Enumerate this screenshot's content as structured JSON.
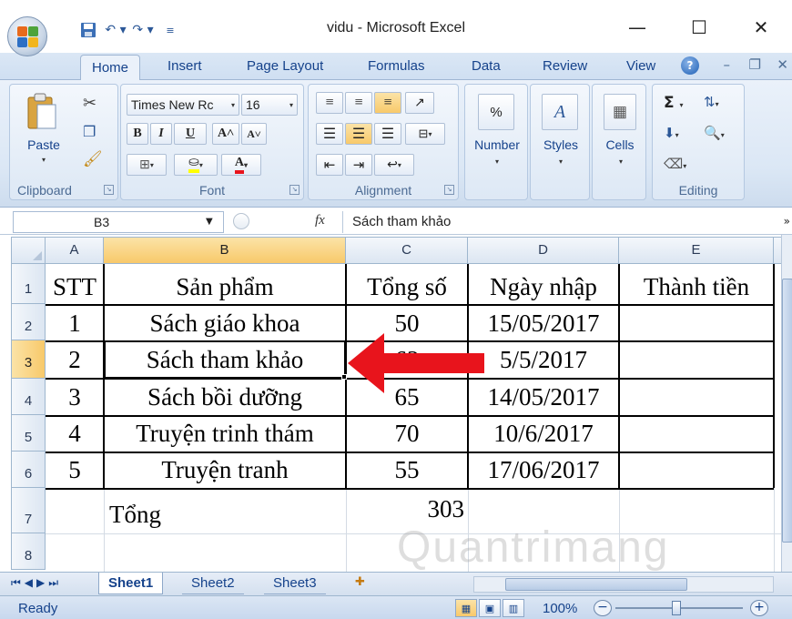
{
  "window": {
    "title": "vidu - Microsoft Excel",
    "minimize": "—",
    "maximize": "☐",
    "close": "✕"
  },
  "qat": {
    "save_icon": "💾",
    "undo": "↶ ▾",
    "redo": "↷ ▾",
    "customize": "≡"
  },
  "tabs": [
    {
      "label": "Home",
      "active": true
    },
    {
      "label": "Insert"
    },
    {
      "label": "Page Layout"
    },
    {
      "label": "Formulas"
    },
    {
      "label": "Data"
    },
    {
      "label": "Review"
    },
    {
      "label": "View"
    }
  ],
  "ribbon": {
    "clipboard": {
      "label": "Clipboard",
      "paste": "Paste"
    },
    "font": {
      "label": "Font",
      "name": "Times New Rc",
      "size": "16",
      "bold": "B",
      "italic": "I",
      "underline": "U",
      "grow": "A˄",
      "shrink": "A˅",
      "color_letter": "A"
    },
    "alignment": {
      "label": "Alignment"
    },
    "number": {
      "label": "Number",
      "percent": "%"
    },
    "styles": {
      "label": "Styles"
    },
    "cells": {
      "label": "Cells"
    },
    "editing": {
      "label": "Editing",
      "sum": "Σ"
    }
  },
  "formula_bar": {
    "name_box": "B3",
    "fx": "fx",
    "content": "Sách tham khảo"
  },
  "columns": [
    "A",
    "B",
    "C",
    "D",
    "E"
  ],
  "rows": [
    "1",
    "2",
    "3",
    "4",
    "5",
    "6",
    "7",
    "8"
  ],
  "table": {
    "header": [
      "STT",
      "Sản phẩm",
      "Tổng số",
      "Ngày nhập",
      "Thành tiền"
    ],
    "rows": [
      [
        "1",
        "Sách giáo khoa",
        "50",
        "15/05/2017",
        ""
      ],
      [
        "2",
        "Sách tham khảo",
        "63",
        "5/5/2017",
        ""
      ],
      [
        "3",
        "Sách bồi dưỡng",
        "65",
        "14/05/2017",
        ""
      ],
      [
        "4",
        "Truyện trinh thám",
        "70",
        "10/6/2017",
        ""
      ],
      [
        "5",
        "Truyện tranh",
        "55",
        "17/06/2017",
        ""
      ]
    ],
    "total_label": "Tổng",
    "total_value": "303"
  },
  "sheets": [
    {
      "label": "Sheet1",
      "active": true
    },
    {
      "label": "Sheet2"
    },
    {
      "label": "Sheet3"
    }
  ],
  "status": {
    "text": "Ready",
    "zoom": "100%",
    "zoom_out": "−",
    "zoom_in": "+"
  },
  "watermark": "Quantrimang",
  "colors": {
    "accent": "#15428b",
    "selection": "#f8c96a",
    "arrow": "#e8141c"
  }
}
